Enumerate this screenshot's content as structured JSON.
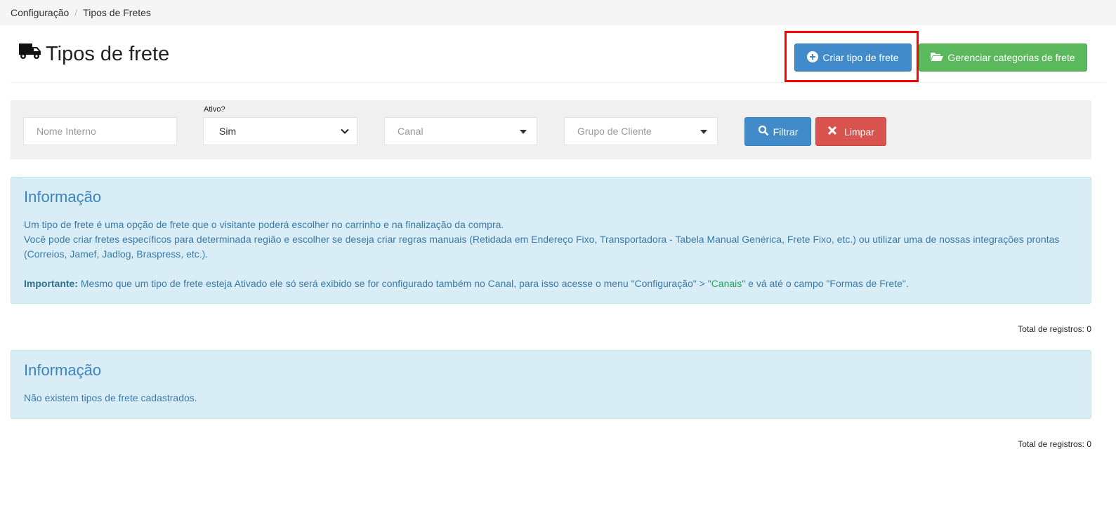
{
  "breadcrumb": {
    "items": [
      "Configuração",
      "Tipos de Fretes"
    ],
    "separator": "/"
  },
  "header": {
    "title": "Tipos de frete",
    "icon": "truck-icon",
    "create_button": "Criar tipo de frete",
    "manage_button": "Gerenciar categorias de frete"
  },
  "filters": {
    "name_placeholder": "Nome Interno",
    "active_label": "Ativo?",
    "active_value": "Sim",
    "channel_placeholder": "Canal",
    "customer_group_placeholder": "Grupo de Cliente",
    "filter_button": "Filtrar",
    "clear_button": "Limpar"
  },
  "info_box": {
    "title": "Informação",
    "line1": "Um tipo de frete é uma opção de frete que o visitante poderá escolher no carrinho e na finalização da compra.",
    "line2": "Você pode criar fretes específicos para determinada região e escolher se deseja criar regras manuais (Retidada em Endereço Fixo, Transportadora - Tabela Manual Genérica, Frete Fixo, etc.) ou utilizar uma de nossas integrações prontas (Correios, Jamef, Jadlog, Braspress, etc.).",
    "important_label": "Importante:",
    "important_text_before": " Mesmo que um tipo de frete esteja Ativado ele só será exibido se for configurado também no Canal, para isso acesse o menu \"Configuração\" > \"",
    "important_link": "Canais",
    "important_text_after": "\" e vá até o campo \"Formas de Frete\"."
  },
  "total_top": "Total de registros: 0",
  "empty_box": {
    "title": "Informação",
    "message": "Não existem tipos de frete cadastrados."
  },
  "total_bottom": "Total de registros: 0",
  "colors": {
    "primary": "#428bca",
    "success": "#5cb85c",
    "danger": "#d9534f",
    "info_bg": "#d9edf7",
    "highlight": "#ff0000"
  }
}
